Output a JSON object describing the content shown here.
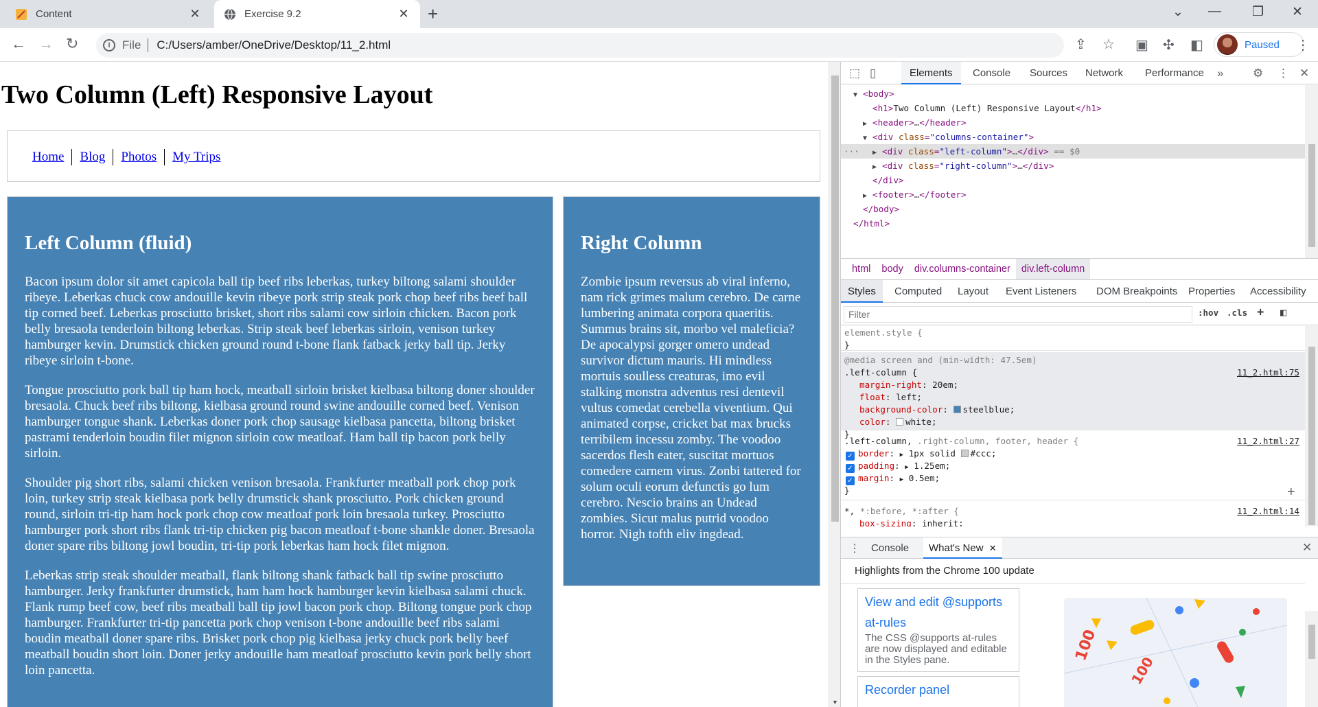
{
  "browser": {
    "tabs": [
      {
        "title": "Content",
        "icon": "note-favicon",
        "active": false
      },
      {
        "title": "Exercise 9.2",
        "icon": "globe-favicon",
        "active": true
      }
    ],
    "address": {
      "scheme": "File",
      "url": "C:/Users/amber/OneDrive/Desktop/11_2.html"
    },
    "profile_label": "Paused"
  },
  "page": {
    "heading": "Two Column (Left) Responsive Layout",
    "nav": [
      "Home",
      "Blog",
      "Photos",
      "My Trips"
    ],
    "left_column": {
      "heading": "Left Column (fluid)",
      "paragraphs": [
        "Bacon ipsum dolor sit amet capicola ball tip beef ribs leberkas, turkey biltong salami shoulder ribeye. Leberkas chuck cow andouille kevin ribeye pork strip steak pork chop beef ribs beef ball tip corned beef. Leberkas prosciutto brisket, short ribs salami cow sirloin chicken. Bacon pork belly bresaola tenderloin biltong leberkas. Strip steak beef leberkas sirloin, venison turkey hamburger kevin. Drumstick chicken ground round t-bone flank fatback jerky ball tip. Jerky ribeye sirloin t-bone.",
        "Tongue prosciutto pork ball tip ham hock, meatball sirloin brisket kielbasa biltong doner shoulder bresaola. Chuck beef ribs biltong, kielbasa ground round swine andouille corned beef. Venison hamburger tongue shank. Leberkas doner pork chop sausage kielbasa pancetta, biltong brisket pastrami tenderloin boudin filet mignon sirloin cow meatloaf. Ham ball tip bacon pork belly sirloin.",
        "Shoulder pig short ribs, salami chicken venison bresaola. Frankfurter meatball pork chop pork loin, turkey strip steak kielbasa pork belly drumstick shank prosciutto. Pork chicken ground round, sirloin tri-tip ham hock pork chop cow meatloaf pork loin bresaola turkey. Prosciutto hamburger pork short ribs flank tri-tip chicken pig bacon meatloaf t-bone shankle doner. Bresaola doner spare ribs biltong jowl boudin, tri-tip pork leberkas ham hock filet mignon.",
        "Leberkas strip steak shoulder meatball, flank biltong shank fatback ball tip swine prosciutto hamburger. Jerky frankfurter drumstick, ham ham hock hamburger kevin kielbasa salami chuck. Flank rump beef cow, beef ribs meatball ball tip jowl bacon pork chop. Biltong tongue pork chop hamburger. Frankfurter tri-tip pancetta pork chop venison t-bone andouille beef ribs salami boudin meatball doner spare ribs. Brisket pork chop pig kielbasa jerky chuck pork belly beef meatball boudin short loin. Doner jerky andouille ham meatloaf prosciutto kevin pork belly short loin pancetta."
      ]
    },
    "right_column": {
      "heading": "Right Column",
      "paragraph": "Zombie ipsum reversus ab viral inferno, nam rick grimes malum cerebro. De carne lumbering animata corpora quaeritis. Summus brains sit, morbo vel maleficia? De apocalypsi gorger omero undead survivor dictum mauris. Hi mindless mortuis soulless creaturas, imo evil stalking monstra adventus resi dentevil vultus comedat cerebella viventium. Qui animated corpse, cricket bat max brucks terribilem incessu zomby. The voodoo sacerdos flesh eater, suscitat mortuos comedere carnem virus. Zonbi tattered for solum oculi eorum defunctis go lum cerebro. Nescio brains an Undead zombies. Sicut malus putrid voodoo horror. Nigh tofth eliv ingdead."
    }
  },
  "devtools": {
    "tabs": [
      "Elements",
      "Console",
      "Sources",
      "Network",
      "Performance"
    ],
    "dom": {
      "body_open": "body",
      "h1_open": "h1",
      "h1_text": "Two Column (Left) Responsive Layout",
      "header": "header",
      "div": "div",
      "class_attr": "class",
      "container_class": "\"columns-container\"",
      "left_class": "\"left-column\"",
      "right_class": "\"right-column\"",
      "selected_marker": "== $0",
      "footer": "footer",
      "html": "html"
    },
    "breadcrumbs": [
      "html",
      "body",
      "div.columns-container",
      "div.left-column"
    ],
    "sub_tabs": [
      "Styles",
      "Computed",
      "Layout",
      "Event Listeners",
      "DOM Breakpoints",
      "Properties",
      "Accessibility"
    ],
    "filter_placeholder": "Filter",
    "filter_buttons": [
      ":hov",
      ".cls"
    ],
    "styles": {
      "element_style": "element.style {",
      "media_query": "@media screen and (min-width: 47.5em)",
      "rule1_selector": ".left-column {",
      "rule1_source": "11_2.html:75",
      "rule1_props": [
        {
          "name": "margin-right",
          "value": "20em;"
        },
        {
          "name": "float",
          "value": "left;"
        },
        {
          "name": "background-color",
          "value": "steelblue;",
          "swatch": "#4682b4"
        },
        {
          "name": "color",
          "value": "white;",
          "swatch": "#ffffff"
        }
      ],
      "rule2_selector_main": ".left-column,",
      "rule2_selector_rest": ".right-column, footer, header {",
      "rule2_source": "11_2.html:27",
      "rule2_props": [
        {
          "name": "border",
          "value": "1px solid",
          "extra": "#ccc;",
          "swatch": "#cccccc"
        },
        {
          "name": "padding",
          "value": "1.25em;"
        },
        {
          "name": "margin",
          "value": "0.5em;"
        }
      ],
      "rule3_selector_main": "*,",
      "rule3_selector_rest": "*:before, *:after {",
      "rule3_source": "11_2.html:14",
      "rule3_prop": {
        "name": "box-sizing",
        "value": "inherit;"
      },
      "close_brace": "}"
    },
    "drawer": {
      "tabs": [
        "Console",
        "What's New"
      ],
      "headline": "Highlights from the Chrome 100 update",
      "cards": [
        {
          "title_line1": "View and edit @supports",
          "title_line2": "at-rules",
          "desc": "The CSS @supports at-rules are now displayed and editable in the Styles pane."
        },
        {
          "title_line1": "Recorder panel"
        }
      ]
    }
  }
}
